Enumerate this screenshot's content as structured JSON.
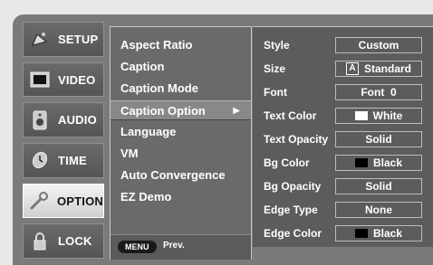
{
  "sidebar": {
    "items": [
      {
        "label": "SETUP",
        "icon": "satellite-dish-icon",
        "active": false
      },
      {
        "label": "VIDEO",
        "icon": "tv-monitor-icon",
        "active": false
      },
      {
        "label": "AUDIO",
        "icon": "speaker-icon",
        "active": false
      },
      {
        "label": "TIME",
        "icon": "clock-icon",
        "active": false
      },
      {
        "label": "OPTION",
        "icon": "wrench-icon",
        "active": true
      },
      {
        "label": "LOCK",
        "icon": "padlock-icon",
        "active": false
      }
    ]
  },
  "option_menu": {
    "items": [
      {
        "label": "Aspect Ratio"
      },
      {
        "label": "Caption"
      },
      {
        "label": "Caption Mode"
      },
      {
        "label": "Caption Option",
        "active": true,
        "arrow": "▶"
      },
      {
        "label": "Language"
      },
      {
        "label": "VM"
      },
      {
        "label": "Auto Convergence"
      },
      {
        "label": "EZ Demo"
      }
    ],
    "footer": {
      "menu_button": "MENU",
      "prev_label": "Prev."
    }
  },
  "caption_options": {
    "rows": [
      {
        "label": "Style",
        "value": "Custom"
      },
      {
        "label": "Size",
        "value": "Standard",
        "prefix": "A"
      },
      {
        "label": "Font",
        "value": "Font  0"
      },
      {
        "label": "Text Color",
        "value": "White",
        "swatch": "#ffffff"
      },
      {
        "label": "Text Opacity",
        "value": "Solid"
      },
      {
        "label": "Bg Color",
        "value": "Black",
        "swatch": "#000000"
      },
      {
        "label": "Bg Opacity",
        "value": "Solid"
      },
      {
        "label": "Edge Type",
        "value": "None"
      },
      {
        "label": "Edge Color",
        "value": "Black",
        "swatch": "#000000"
      }
    ]
  },
  "colors": {
    "active_tab": "#e6e6e6",
    "panel": "#5c5c5c",
    "frame": "#7a7a7a"
  }
}
